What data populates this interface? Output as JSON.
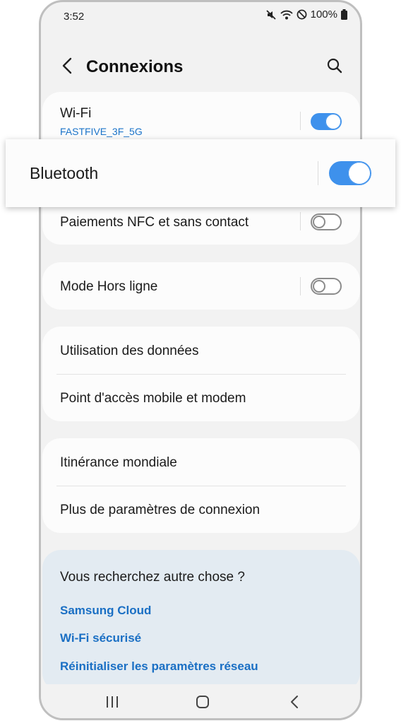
{
  "status": {
    "time": "3:52",
    "battery": "100%",
    "icons": [
      "mute-icon",
      "wifi-icon",
      "do-not-disturb-icon",
      "battery-icon"
    ]
  },
  "header": {
    "title": "Connexions",
    "back_icon": "back-arrow-icon",
    "search_icon": "search-icon"
  },
  "settings": {
    "wifi": {
      "label": "Wi-Fi",
      "network": "FASTFIVE_3F_5G",
      "enabled": true
    },
    "bluetooth": {
      "label": "Bluetooth",
      "enabled": true
    },
    "nfc": {
      "label": "Paiements NFC et sans contact",
      "enabled": false
    },
    "airplane": {
      "label": "Mode Hors ligne",
      "enabled": false
    },
    "data_usage": {
      "label": "Utilisation des données"
    },
    "hotspot": {
      "label": "Point d'accès mobile et modem"
    },
    "roaming": {
      "label": "Itinérance mondiale"
    },
    "more": {
      "label": "Plus de paramètres de connexion"
    }
  },
  "suggestions": {
    "title": "Vous recherchez autre chose ?",
    "links": [
      "Samsung Cloud",
      "Wi-Fi sécurisé",
      "Réinitialiser les paramètres réseau"
    ]
  },
  "navbar": {
    "icons": [
      "recent-apps-icon",
      "home-icon",
      "back-icon"
    ]
  },
  "colors": {
    "accent": "#3e91ec",
    "link": "#1a6fc4",
    "background": "#f2f2f2",
    "card": "#fcfcfc",
    "suggest_bg": "#e3ebf2"
  }
}
